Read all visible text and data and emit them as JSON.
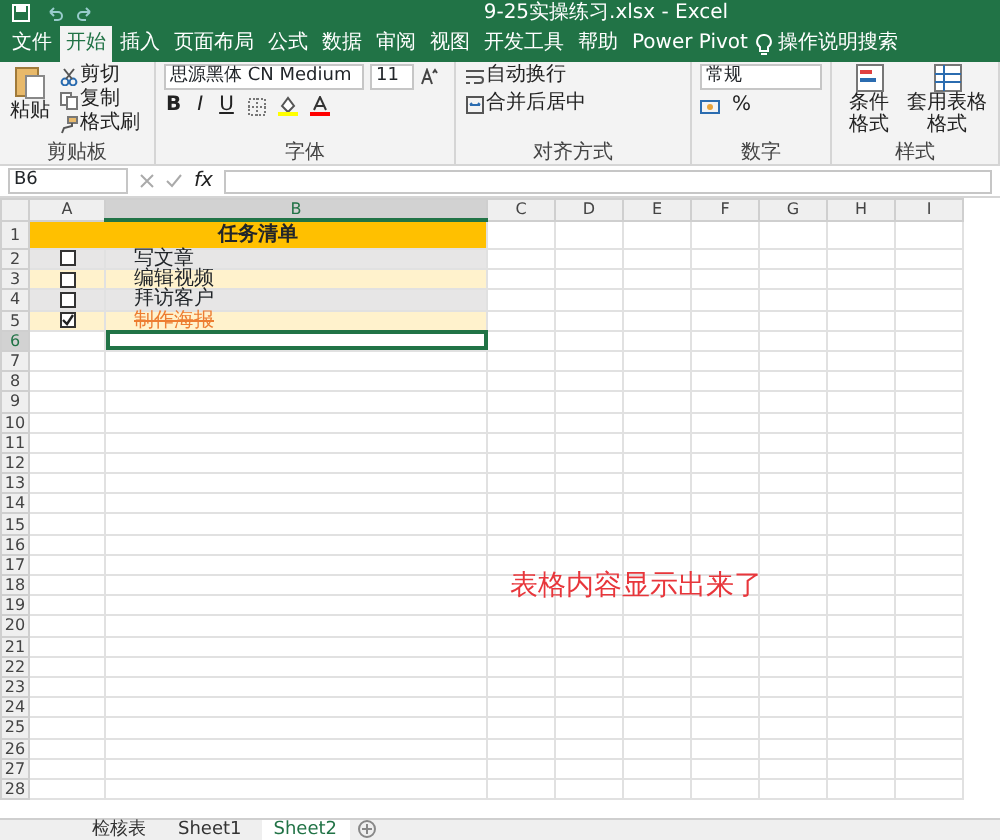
{
  "window": {
    "title": "9-25实操练习.xlsx - Excel"
  },
  "ribbon_tabs": [
    {
      "label": "文件",
      "selected": false
    },
    {
      "label": "开始",
      "selected": true
    },
    {
      "label": "插入",
      "selected": false
    },
    {
      "label": "页面布局",
      "selected": false
    },
    {
      "label": "公式",
      "selected": false
    },
    {
      "label": "数据",
      "selected": false
    },
    {
      "label": "审阅",
      "selected": false
    },
    {
      "label": "视图",
      "selected": false
    },
    {
      "label": "开发工具",
      "selected": false
    },
    {
      "label": "帮助",
      "selected": false
    },
    {
      "label": "Power Pivot",
      "selected": false
    }
  ],
  "tell_me": "操作说明搜索",
  "ribbon": {
    "clipboard": {
      "paste": "粘贴",
      "cut": "剪切",
      "copy": "复制",
      "format_painter": "格式刷",
      "label": "剪贴板"
    },
    "font": {
      "name": "思源黑体 CN Medium",
      "size": "11",
      "bold": "B",
      "italic": "I",
      "underline": "U",
      "label": "字体"
    },
    "alignment": {
      "wrap": "自动换行",
      "merge": "合并后居中",
      "label": "对齐方式"
    },
    "number": {
      "format": "常规",
      "percent": "%",
      "label": "数字"
    },
    "styles": {
      "conditional": "条件格式",
      "table_format": "套用表格格式",
      "label": "样式"
    }
  },
  "formula_bar": {
    "name_box": "B6",
    "fx": "fx"
  },
  "columns": [
    {
      "label": "A",
      "selected": false
    },
    {
      "label": "B",
      "selected": true
    },
    {
      "label": "C",
      "selected": false
    },
    {
      "label": "D",
      "selected": false
    },
    {
      "label": "E",
      "selected": false
    },
    {
      "label": "F",
      "selected": false
    },
    {
      "label": "G",
      "selected": false
    },
    {
      "label": "H",
      "selected": false
    },
    {
      "label": "I",
      "selected": false
    }
  ],
  "rows": [
    {
      "label": "1",
      "selected": false
    },
    {
      "label": "2",
      "selected": false
    },
    {
      "label": "3",
      "selected": false
    },
    {
      "label": "4",
      "selected": false
    },
    {
      "label": "5",
      "selected": false
    },
    {
      "label": "6",
      "selected": true
    },
    {
      "label": "7",
      "selected": false
    },
    {
      "label": "8",
      "selected": false
    },
    {
      "label": "9",
      "selected": false
    },
    {
      "label": "10",
      "selected": false
    },
    {
      "label": "11",
      "selected": false
    },
    {
      "label": "12",
      "selected": false
    },
    {
      "label": "13",
      "selected": false
    },
    {
      "label": "14",
      "selected": false
    },
    {
      "label": "15",
      "selected": false
    },
    {
      "label": "16",
      "selected": false
    },
    {
      "label": "17",
      "selected": false
    },
    {
      "label": "18",
      "selected": false
    },
    {
      "label": "19",
      "selected": false
    },
    {
      "label": "20",
      "selected": false
    },
    {
      "label": "21",
      "selected": false
    },
    {
      "label": "22",
      "selected": false
    },
    {
      "label": "23",
      "selected": false
    },
    {
      "label": "24",
      "selected": false
    },
    {
      "label": "25",
      "selected": false
    },
    {
      "label": "26",
      "selected": false
    },
    {
      "label": "27",
      "selected": false
    },
    {
      "label": "28",
      "selected": false
    }
  ],
  "task_table": {
    "title": "任务清单",
    "tasks": [
      {
        "text": "写文章",
        "checked": false
      },
      {
        "text": "编辑视频",
        "checked": false
      },
      {
        "text": "拜访客户",
        "checked": false
      },
      {
        "text": "制作海报",
        "checked": true
      }
    ]
  },
  "annotation": "表格内容显示出来了",
  "sheet_tabs": [
    {
      "label": "检核表",
      "selected": false
    },
    {
      "label": "Sheet1",
      "selected": false
    },
    {
      "label": "Sheet2",
      "selected": true
    }
  ]
}
